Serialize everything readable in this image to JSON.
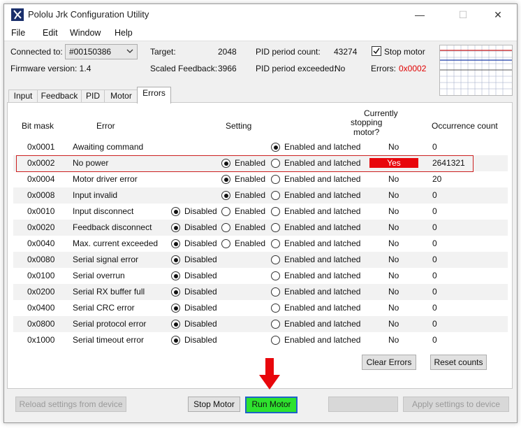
{
  "window": {
    "title": "Pololu Jrk Configuration Utility"
  },
  "menu": [
    {
      "label": "File"
    },
    {
      "label": "Edit"
    },
    {
      "label": "Window"
    },
    {
      "label": "Help"
    }
  ],
  "status": {
    "connected_label": "Connected to:",
    "connected_value": "#00150386",
    "firmware_label": "Firmware version: 1.4",
    "target_label": "Target:",
    "target_value": "2048",
    "scaled_feedback_label": "Scaled Feedback:",
    "scaled_feedback_value": "3966",
    "pid_count_label": "PID period count:",
    "pid_count_value": "43274",
    "pid_exceeded_label": "PID period exceeded:",
    "pid_exceeded_value": "No",
    "stop_motor_label": "Stop motor",
    "stop_motor_checked": true,
    "errors_label": "Errors:",
    "errors_value": "0x0002"
  },
  "tabs": [
    {
      "label": "Input"
    },
    {
      "label": "Feedback"
    },
    {
      "label": "PID"
    },
    {
      "label": "Motor"
    },
    {
      "label": "Errors",
      "active": true
    }
  ],
  "errors_table": {
    "headers": {
      "bitmask": "Bit mask",
      "error": "Error",
      "setting": "Setting",
      "stopping_line1": "Currently",
      "stopping_line2": "stopping motor?",
      "count": "Occurrence count"
    },
    "option_labels": {
      "disabled": "Disabled",
      "enabled": "Enabled",
      "latched": "Enabled and latched"
    },
    "rows": [
      {
        "mask": "0x0001",
        "name": "Awaiting command",
        "options": [
          "latched"
        ],
        "selected": "latched",
        "stopping": "No",
        "count": "0"
      },
      {
        "mask": "0x0002",
        "name": "No power",
        "options": [
          "enabled",
          "latched"
        ],
        "selected": "enabled",
        "stopping": "Yes",
        "count": "2641321"
      },
      {
        "mask": "0x0004",
        "name": "Motor driver error",
        "options": [
          "enabled",
          "latched"
        ],
        "selected": "enabled",
        "stopping": "No",
        "count": "20"
      },
      {
        "mask": "0x0008",
        "name": "Input invalid",
        "options": [
          "enabled",
          "latched"
        ],
        "selected": "enabled",
        "stopping": "No",
        "count": "0"
      },
      {
        "mask": "0x0010",
        "name": "Input disconnect",
        "options": [
          "disabled",
          "enabled",
          "latched"
        ],
        "selected": "disabled",
        "stopping": "No",
        "count": "0"
      },
      {
        "mask": "0x0020",
        "name": "Feedback disconnect",
        "options": [
          "disabled",
          "enabled",
          "latched"
        ],
        "selected": "disabled",
        "stopping": "No",
        "count": "0"
      },
      {
        "mask": "0x0040",
        "name": "Max. current exceeded",
        "options": [
          "disabled",
          "enabled",
          "latched"
        ],
        "selected": "disabled",
        "stopping": "No",
        "count": "0"
      },
      {
        "mask": "0x0080",
        "name": "Serial signal error",
        "options": [
          "disabled",
          "latched"
        ],
        "selected": "disabled",
        "stopping": "No",
        "count": "0"
      },
      {
        "mask": "0x0100",
        "name": "Serial overrun",
        "options": [
          "disabled",
          "latched"
        ],
        "selected": "disabled",
        "stopping": "No",
        "count": "0"
      },
      {
        "mask": "0x0200",
        "name": "Serial RX buffer full",
        "options": [
          "disabled",
          "latched"
        ],
        "selected": "disabled",
        "stopping": "No",
        "count": "0"
      },
      {
        "mask": "0x0400",
        "name": "Serial CRC error",
        "options": [
          "disabled",
          "latched"
        ],
        "selected": "disabled",
        "stopping": "No",
        "count": "0"
      },
      {
        "mask": "0x0800",
        "name": "Serial protocol error",
        "options": [
          "disabled",
          "latched"
        ],
        "selected": "disabled",
        "stopping": "No",
        "count": "0"
      },
      {
        "mask": "0x1000",
        "name": "Serial timeout error",
        "options": [
          "disabled",
          "latched"
        ],
        "selected": "disabled",
        "stopping": "No",
        "count": "0"
      }
    ]
  },
  "buttons": {
    "clear_errors": "Clear Errors",
    "reset_counts": "Reset counts",
    "reload": "Reload settings from device",
    "stop_motor": "Stop Motor",
    "run_motor": "Run Motor",
    "blank": "",
    "apply": "Apply settings to device"
  },
  "colors": {
    "yes_badge": "#e8070c",
    "errors_value": "#e00000",
    "run_motor_bg": "#2ee22e",
    "arrow": "#e8070c"
  }
}
